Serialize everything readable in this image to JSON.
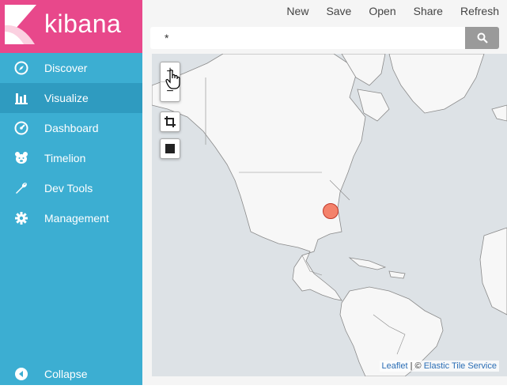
{
  "brand": {
    "name": "kibana"
  },
  "sidebar": {
    "items": [
      {
        "label": "Discover",
        "icon": "compass-icon"
      },
      {
        "label": "Visualize",
        "icon": "bar-chart-icon",
        "active": true
      },
      {
        "label": "Dashboard",
        "icon": "dashboard-icon"
      },
      {
        "label": "Timelion",
        "icon": "bear-icon"
      },
      {
        "label": "Dev Tools",
        "icon": "wrench-icon"
      },
      {
        "label": "Management",
        "icon": "gear-icon"
      }
    ],
    "collapse_label": "Collapse"
  },
  "toolbar": {
    "new_label": "New",
    "save_label": "Save",
    "open_label": "Open",
    "share_label": "Share",
    "refresh_label": "Refresh"
  },
  "search": {
    "value": "*"
  },
  "map": {
    "zoom_in": "+",
    "zoom_out": "−",
    "attribution_leaflet": "Leaflet",
    "attribution_sep": " | © ",
    "attribution_tiles": "Elastic Tile Service"
  },
  "colors": {
    "brand": "#e8488b",
    "sidebar": "#3caed2",
    "marker": "#f4826b"
  }
}
